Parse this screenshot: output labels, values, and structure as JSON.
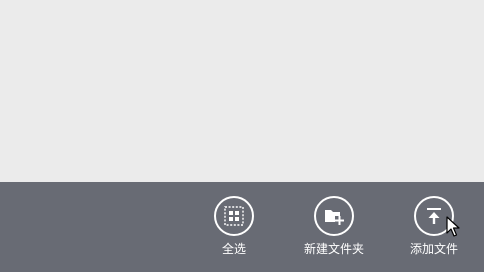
{
  "app_bar": {
    "background": "#686b74",
    "commands": [
      {
        "label": "全选",
        "icon": "select-all-icon"
      },
      {
        "label": "新建文件夹",
        "icon": "new-folder-icon"
      },
      {
        "label": "添加文件",
        "icon": "upload-icon"
      }
    ]
  },
  "content_area": {
    "background": "#ebebeb"
  }
}
